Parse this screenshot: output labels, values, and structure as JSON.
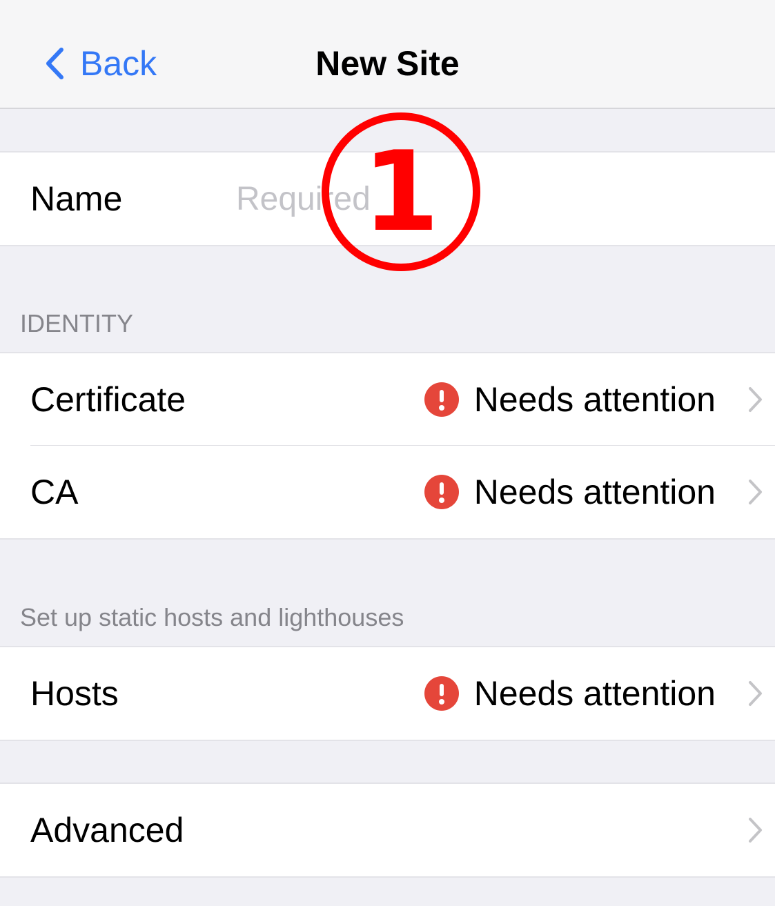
{
  "nav": {
    "back_label": "Back",
    "title": "New Site"
  },
  "name_row": {
    "label": "Name",
    "placeholder": "Required",
    "value": ""
  },
  "identity": {
    "header": "IDENTITY",
    "rows": [
      {
        "label": "Certificate",
        "status": "Needs attention",
        "status_icon": "alert-circle-icon"
      },
      {
        "label": "CA",
        "status": "Needs attention",
        "status_icon": "alert-circle-icon"
      }
    ]
  },
  "hosts_section": {
    "header": "Set up static hosts and lighthouses",
    "rows": [
      {
        "label": "Hosts",
        "status": "Needs attention",
        "status_icon": "alert-circle-icon"
      }
    ]
  },
  "advanced": {
    "label": "Advanced"
  },
  "annotation": {
    "label": "1"
  },
  "colors": {
    "accent": "#3478f6",
    "alert": "#e5463a",
    "annotation": "#ff0000",
    "background": "#f0f0f5"
  }
}
